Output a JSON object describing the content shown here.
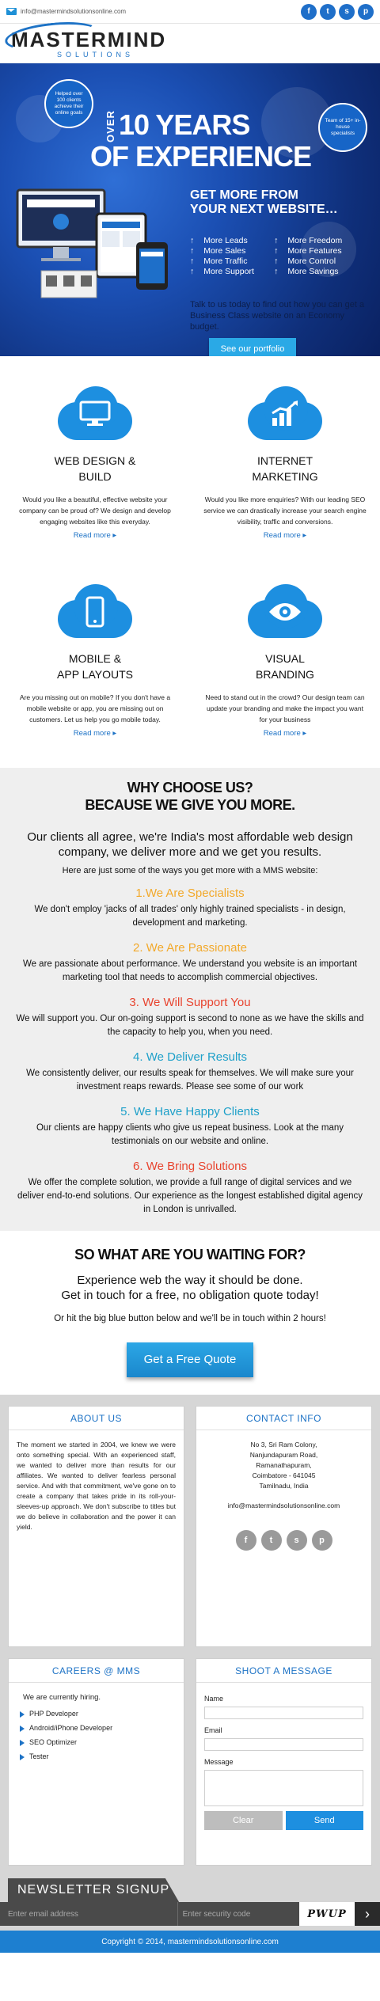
{
  "topbar": {
    "email": "info@mastermindsolutionsonline.com",
    "social": [
      "f",
      "t",
      "s",
      "p"
    ]
  },
  "logo": {
    "name": "MASTERMIND",
    "sub": "SOLUTIONS"
  },
  "hero": {
    "badge_left": "Helped over 100 clients achieve their online goals",
    "badge_right": "Team of 15+ in-house specialists",
    "over": "OVER",
    "years": "10 YEARS",
    "experience": "OF EXPERIENCE",
    "getmore_1": "GET MORE FROM",
    "getmore_2": "YOUR NEXT WEBSITE…",
    "features": [
      "More Leads",
      "More Freedom",
      "More Sales",
      "More Features",
      "More Traffic",
      "More Control",
      "More Support",
      "More Savings"
    ],
    "talk": "Talk to us today to find out how you can get a Business Class website on an Economy budget.",
    "portfolio_label": "See our portfolio"
  },
  "services": [
    {
      "t1": "WEB DESIGN &",
      "t2": "BUILD",
      "desc": "Would you like a beautiful, effective website your company can be proud of? We design and develop engaging websites like this everyday.",
      "more": "Read more",
      "icon": "monitor-icon"
    },
    {
      "t1": "INTERNET",
      "t2": "MARKETING",
      "desc": "Would you like more enquiries? With our leading SEO service we can drastically increase your search engine visibility, traffic and conversions.",
      "more": "Read more",
      "icon": "chart-icon"
    },
    {
      "t1": "MOBILE &",
      "t2": "APP LAYOUTS",
      "desc": "Are you missing out on mobile? If you don't have a mobile website or app, you are missing out on customers. Let us help you go mobile today.",
      "more": "Read more",
      "icon": "phone-icon"
    },
    {
      "t1": "VISUAL",
      "t2": "BRANDING",
      "desc": "Need to stand out in the crowd? Our design team can update your branding and make the impact you want for your business",
      "more": "Read more",
      "icon": "eye-icon"
    }
  ],
  "why": {
    "h1": "WHY CHOOSE US?",
    "h2": "BECAUSE WE GIVE YOU MORE.",
    "lead": "Our clients all agree, we're India's most affordable web design company, we deliver more and we get you results.",
    "sub": "Here are just some of the ways you get more with a MMS website:",
    "items": [
      {
        "title": "1.We Are Specialists",
        "color": "#f2a92b",
        "text": "We don't employ 'jacks of all trades' only highly trained specialists - in design, development and marketing."
      },
      {
        "title": "2. We Are Passionate",
        "color": "#f2a92b",
        "text": "We are passionate about performance. We understand you website is an important marketing tool that needs to accomplish commercial objectives."
      },
      {
        "title": "3. We Will Support You",
        "color": "#e8442f",
        "text": "We will support you. Our on-going support is second to none as we have the skills and the capacity to help you, when you need."
      },
      {
        "title": "4. We Deliver Results",
        "color": "#1ea0c9",
        "text": "We consistently deliver, our results speak for themselves. We will make sure your investment reaps rewards. Please see some of our work"
      },
      {
        "title": "5. We Have Happy Clients",
        "color": "#1ea0c9",
        "text": "Our clients are happy clients who give us repeat business. Look at the many testimonials on our website and online."
      },
      {
        "title": "6. We Bring Solutions",
        "color": "#e8442f",
        "text": "We offer the complete solution, we provide a full range of digital services and we deliver end-to-end solutions. Our experience as the longest established digital agency in London is unrivalled."
      }
    ]
  },
  "waiting": {
    "h": "SO WHAT ARE YOU WAITING FOR?",
    "l1": "Experience web the way it should be done.",
    "l2": "Get in touch for a free, no obligation quote today!",
    "s": "Or hit the big blue button below and we'll be in touch within 2 hours!",
    "btn": "Get a Free Quote"
  },
  "about": {
    "title": "ABOUT US",
    "text": "The moment we started in 2004, we knew we were onto something special. With an experienced staff, we wanted to deliver more than results for our affiliates. We wanted to deliver fearless personal service. And with that commitment, we've gone on to create a company that takes pride in its roll-your-sleeves-up approach. We don't subscribe to titles but we do believe in collaboration and the power it can yield."
  },
  "contact": {
    "title": "CONTACT INFO",
    "addr1": "No 3, Sri Ram Colony,",
    "addr2": "Nanjundapuram Road,",
    "addr3": "Ramanathapuram,",
    "addr4": "Coimbatore - 641045",
    "addr5": "Tamilnadu, India",
    "email": "info@mastermindsolutionsonline.com"
  },
  "careers": {
    "title": "CAREERS @ MMS",
    "intro": "We are currently hiring.",
    "jobs": [
      "PHP Developer",
      "Android/iPhone Developer",
      "SEO Optimizer",
      "Tester"
    ]
  },
  "message": {
    "title": "SHOOT A MESSAGE",
    "name": "Name",
    "email": "Email",
    "message": "Message",
    "clear": "Clear",
    "send": "Send"
  },
  "newsletter": {
    "title": "NEWSLETTER SIGNUP",
    "email_ph": "Enter email address",
    "code_ph": "Enter security code",
    "captcha": "PWUP",
    "go": "›"
  },
  "copyright": "Copyright © 2014, mastermindsolutionsonline.com"
}
